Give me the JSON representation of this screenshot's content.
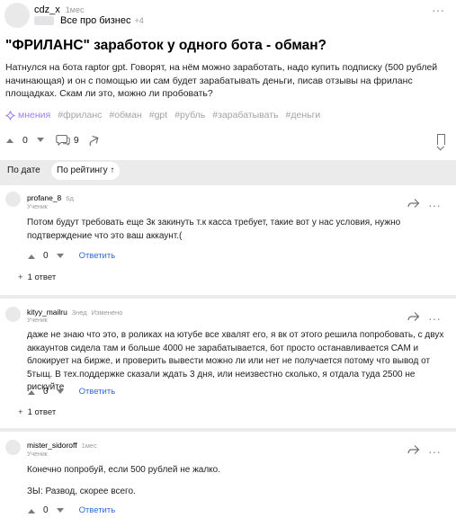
{
  "post": {
    "author": "cdz_x",
    "time": "1мес",
    "category": "Все про бизнес",
    "category_extra": "+4",
    "title": "\"ФРИЛАНС\" заработок у одного бота - обман?",
    "body": "Натнулся на бота raptor gpt. Говорят, на нём можно заработать, надо купить подписку (500 рублей начинающая) и он с помощью ии сам будет зарабатывать деньги, писав отзывы на фриланс площадках. Скам ли это, можно ли пробовать?",
    "tags": [
      "мнения",
      "#фриланс",
      "#обман",
      "#gpt",
      "#рубль",
      "#зарабатывать",
      "#деньги"
    ],
    "votes": "0",
    "comments_count": "9"
  },
  "sort": {
    "by_date": "По дате",
    "by_rating": "По рейтингу ↑"
  },
  "comments": [
    {
      "author": "profane_8",
      "time": "6д",
      "role": "Ученик",
      "lines": [
        "Потом будут требовать еще 3к закинуть т.к касса требует, такие вот у нас условия, нужно",
        "подтверждение что это ваш аккаунт.("
      ],
      "votes": "0",
      "reply_label": "Ответить",
      "replies": "1 ответ"
    },
    {
      "author": "kityy_mailru",
      "time": "3нед",
      "edited": "Изменено",
      "role": "Ученик",
      "lines": [
        "даже не знаю что это, в роликах на ютубе все хвалят его, я вк от этого решила попробовать, с двух",
        "аккаунтов сидела там и больше 4000 не зарабатывается, бот просто останавливается САМ и",
        "блокирует на бирже, и проверить вывести можно ли или нет не получается потому что вывод от",
        "5тыщ. В тех.поддержке сказали ждать 3 дня, или неизвестно сколько, я отдала туда 2500 не рискуйте"
      ],
      "votes": "0",
      "reply_label": "Ответить",
      "replies": "1 ответ"
    },
    {
      "author": "mister_sidoroff",
      "time": "1мес",
      "role": "Ученик",
      "lines": [
        "Конечно попробуй, если 500 рублей не жалко.",
        "ЗЫ: Развод, скорее всего."
      ],
      "votes": "0",
      "reply_label": "Ответить"
    }
  ],
  "colors": {
    "accent_link": "#2b6bd6",
    "tag_highlight": "#9f7de8",
    "page_bg": "#ebebeb"
  },
  "icons": [
    "more-icon",
    "upvote-icon",
    "downvote-icon",
    "comment-icon",
    "share-icon",
    "bookmark-icon",
    "sparkle-icon",
    "reply-arrow-icon"
  ]
}
